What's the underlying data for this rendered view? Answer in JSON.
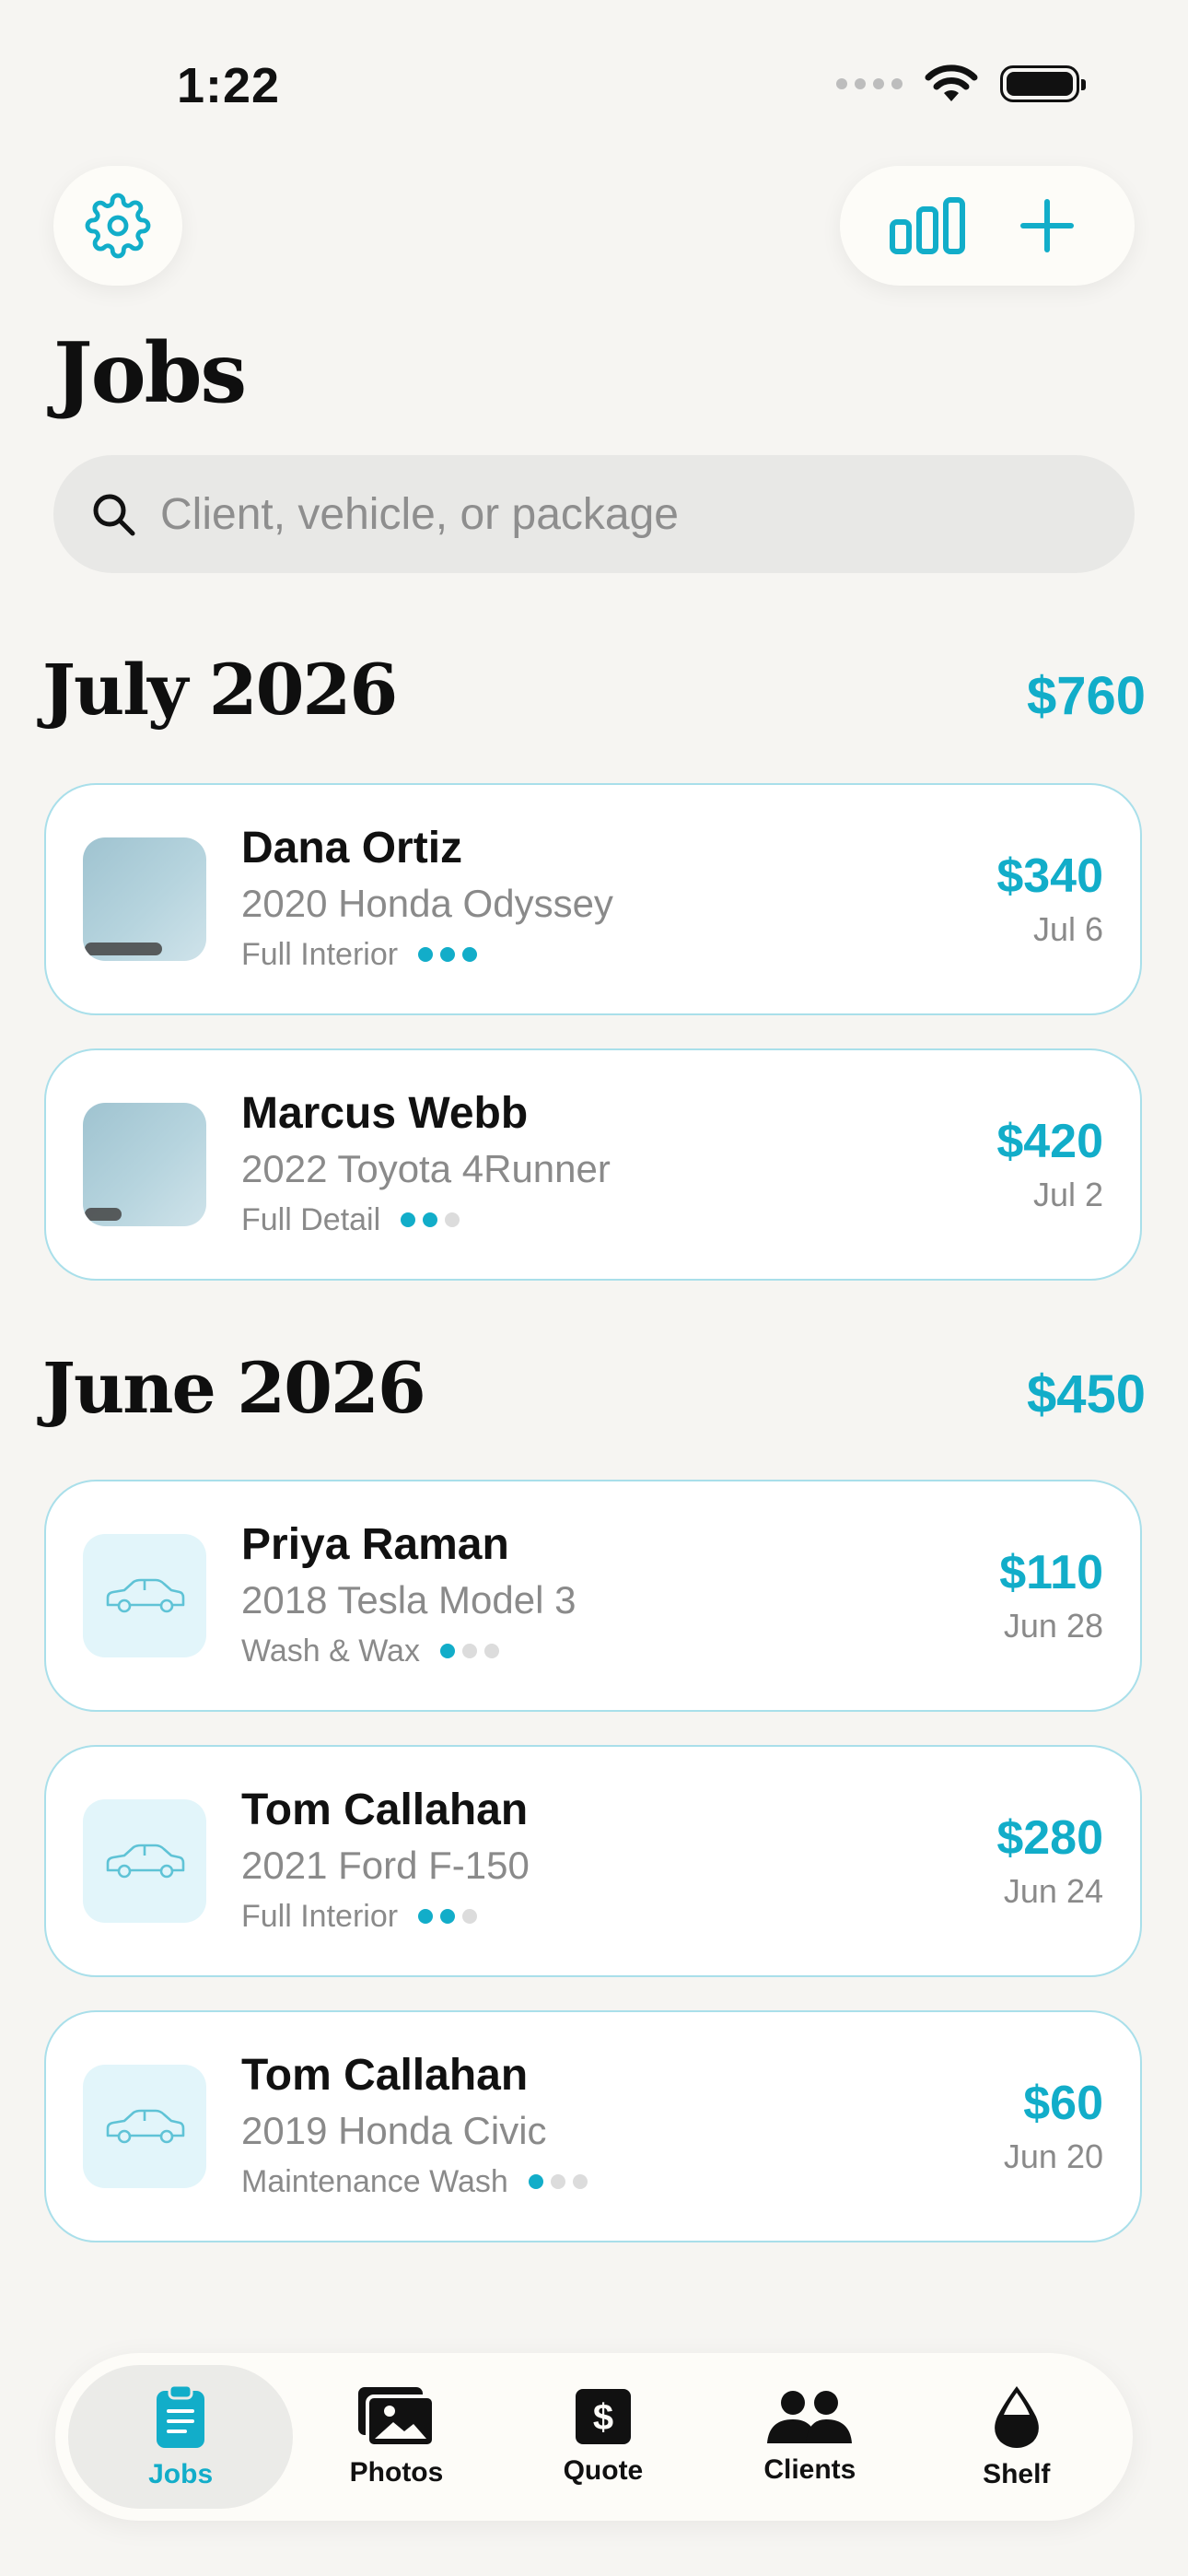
{
  "status_bar": {
    "time": "1:22"
  },
  "header": {
    "title": "Jobs"
  },
  "search": {
    "placeholder": "Client, vehicle, or package"
  },
  "colors": {
    "accent": "#12adc9",
    "background": "#f6f5f2",
    "card_border": "#a9dfea"
  },
  "sections": [
    {
      "title": "July 2026",
      "total": "$760",
      "jobs": [
        {
          "client": "Dana Ortiz",
          "vehicle": "2020 Honda Odyssey",
          "package": "Full Interior",
          "amount": "$340",
          "date": "Jul 6",
          "progress_steps_complete": 3,
          "progress_steps_total": 3,
          "thumbnail": "photo"
        },
        {
          "client": "Marcus Webb",
          "vehicle": "2022 Toyota 4Runner",
          "package": "Full Detail",
          "amount": "$420",
          "date": "Jul 2",
          "progress_steps_complete": 2,
          "progress_steps_total": 3,
          "thumbnail": "photo"
        }
      ]
    },
    {
      "title": "June 2026",
      "total": "$450",
      "jobs": [
        {
          "client": "Priya Raman",
          "vehicle": "2018 Tesla Model 3",
          "package": "Wash & Wax",
          "amount": "$110",
          "date": "Jun 28",
          "progress_steps_complete": 1,
          "progress_steps_total": 3,
          "thumbnail": "car-icon"
        },
        {
          "client": "Tom Callahan",
          "vehicle": "2021 Ford F-150",
          "package": "Full Interior",
          "amount": "$280",
          "date": "Jun 24",
          "progress_steps_complete": 2,
          "progress_steps_total": 3,
          "thumbnail": "car-icon"
        },
        {
          "client": "Tom Callahan",
          "vehicle": "2019 Honda Civic",
          "package": "Maintenance Wash",
          "amount": "$60",
          "date": "Jun 20",
          "progress_steps_complete": 1,
          "progress_steps_total": 3,
          "thumbnail": "car-icon"
        }
      ]
    }
  ],
  "tab_bar": {
    "tabs": [
      {
        "label": "Jobs",
        "icon": "clipboard-icon",
        "active": true
      },
      {
        "label": "Photos",
        "icon": "photos-icon",
        "active": false
      },
      {
        "label": "Quote",
        "icon": "dollar-icon",
        "active": false
      },
      {
        "label": "Clients",
        "icon": "people-icon",
        "active": false
      },
      {
        "label": "Shelf",
        "icon": "drop-icon",
        "active": false
      }
    ]
  }
}
